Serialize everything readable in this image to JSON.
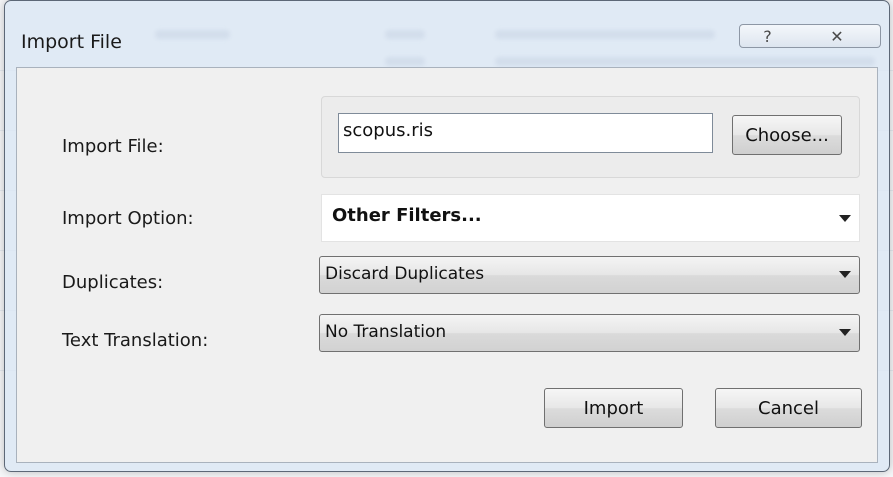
{
  "window": {
    "title": "Import File",
    "help_glyph": "?",
    "close_glyph": "✕"
  },
  "form": {
    "import_file": {
      "label": "Import File:",
      "value": "scopus.ris",
      "choose_label": "Choose..."
    },
    "import_option": {
      "label": "Import Option:",
      "value": "Other Filters..."
    },
    "duplicates": {
      "label": "Duplicates:",
      "value": "Discard Duplicates"
    },
    "text_translation": {
      "label": "Text Translation:",
      "value": "No Translation"
    }
  },
  "buttons": {
    "import": "Import",
    "cancel": "Cancel"
  },
  "colors": {
    "frame": "#dae6f4",
    "client": "#f0f0f0"
  },
  "icons": [
    "help-icon",
    "close-icon",
    "dropdown-arrow-icon"
  ]
}
